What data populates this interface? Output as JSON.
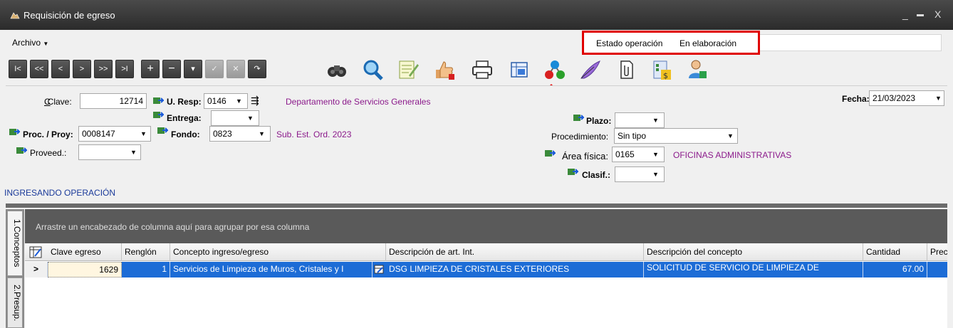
{
  "window": {
    "title": "Requisición de egreso",
    "minimize": "_",
    "maximize": "▬",
    "close": "X"
  },
  "menu": {
    "archivo": "Archivo",
    "archivo_arrow": "▼"
  },
  "estado": {
    "label": "Estado operación",
    "value": "En elaboración",
    "highlight_color": "#e00000"
  },
  "toolbar": {
    "nav_buttons": [
      "I<",
      "<<",
      "<",
      ">",
      ">>",
      ">I",
      "+",
      "−",
      "▾",
      "✓",
      "✕",
      "↷"
    ],
    "icons": [
      "binoculars-icon",
      "magnifier-icon",
      "edit-document-icon",
      "thumbs-up-icon",
      "printer-icon",
      "grid-icon",
      "workflow-icon",
      "quill-icon",
      "attachment-icon",
      "money-document-icon",
      "user-icon"
    ]
  },
  "form": {
    "clave_label": "Clave:",
    "clave_value": "12714",
    "uresp_label": "U. Resp:",
    "uresp_value": "0146",
    "uresp_desc": "Departamento de Servicios Generales",
    "entrega_label": "Entrega:",
    "proc_label": "Proc. / Proy:",
    "proc_value": "0008147",
    "fondo_label": "Fondo:",
    "fondo_value": "0823",
    "fondo_desc": "Sub. Est. Ord. 2023",
    "proveed_label": "Proveed.:",
    "plazo_label": "Plazo:",
    "procedimiento_label": "Procedimiento:",
    "procedimiento_value": "Sin tipo",
    "area_label": "Área física:",
    "area_value": "0165",
    "area_desc": "OFICINAS ADMINISTRATIVAS",
    "clasif_label": "Clasif.:",
    "fecha_label": "Fecha:",
    "fecha_value": "21/03/2023",
    "status": "INGRESANDO OPERACIÓN",
    "dropdown_arrow": "▼"
  },
  "side_tabs": [
    "1.Conceptos",
    "2.Presup."
  ],
  "grid": {
    "group_hint": "Arrastre un encabezado de columna aquí para agrupar por esa columna",
    "columns": [
      "Clave egreso",
      "Renglón",
      "Concepto ingreso/egreso",
      "Descripción de art. Int.",
      "Descripción del concepto",
      "Cantidad",
      "Prec"
    ],
    "row_indicator": ">",
    "rows": [
      {
        "clave": "1629",
        "renglon": "1",
        "concepto": "Servicios de Limpieza de Muros, Cristales y I",
        "desc_art": "DSG LIMPIEZA DE CRISTALES EXTERIORES",
        "desc_concepto": "SOLICITUD DE SERVICIO DE LIMPIEZA DE",
        "cantidad": "67.00"
      }
    ]
  }
}
